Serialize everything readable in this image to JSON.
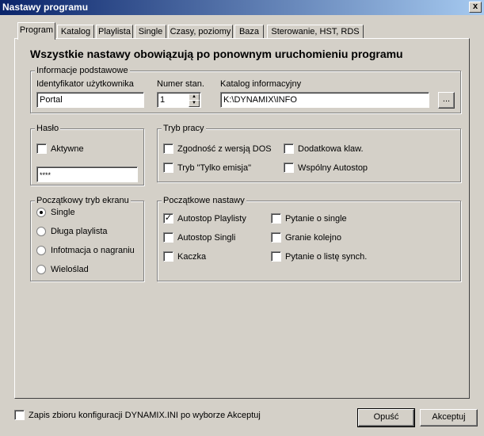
{
  "window": {
    "title": "Nastawy programu",
    "close_glyph": "x"
  },
  "tabs": [
    "Program",
    "Katalog",
    "Playlista",
    "Single",
    "Czasy, poziomy",
    "Baza",
    "Sterowanie, HST, RDS"
  ],
  "heading": "Wszystkie nastawy obowiązują po ponownym uruchomieniu programu",
  "basic": {
    "legend": "Informacje podstawowe",
    "user_id_label": "Identyfikator użytkownika",
    "user_id_value": "Portal",
    "station_label": "Numer stan.",
    "station_value": "1",
    "catalog_label": "Katalog informacyjny",
    "catalog_value": "K:\\DYNAMIX\\INFO",
    "browse_label": "..."
  },
  "password": {
    "legend": "Hasło",
    "active_label": "Aktywne",
    "active_checked": false,
    "value": "****"
  },
  "mode": {
    "legend": "Tryb pracy",
    "items": [
      {
        "label": "Zgodność z wersją DOS",
        "checked": false
      },
      {
        "label": "Dodatkowa klaw.",
        "checked": false
      },
      {
        "label": "Tryb \"Tylko emisja\"",
        "checked": false
      },
      {
        "label": "Wspólny Autostop",
        "checked": false
      }
    ]
  },
  "screen": {
    "legend": "Początkowy tryb ekranu",
    "options": [
      "Single",
      "Długa playlista",
      "Infotmacja o nagraniu",
      "Wieloślad"
    ],
    "selected": "Single"
  },
  "initial": {
    "legend": "Początkowe nastawy",
    "items": [
      {
        "label": "Autostop Playlisty",
        "checked": true
      },
      {
        "label": "Pytanie o single",
        "checked": false
      },
      {
        "label": "Autostop Singli",
        "checked": false
      },
      {
        "label": "Granie kolejno",
        "checked": false
      },
      {
        "label": "Kaczka",
        "checked": false
      },
      {
        "label": "Pytanie o listę synch.",
        "checked": false
      }
    ]
  },
  "footer": {
    "save_config_label": "Zapis zbioru konfiguracji DYNAMIX.INI po wyborze Akceptuj",
    "save_config_checked": false,
    "cancel_label": "Opuść",
    "accept_label": "Akceptuj"
  },
  "icons": {
    "check": "✓",
    "spin_up": "▲",
    "spin_down": "▼"
  },
  "colors": {
    "title_start": "#0a246a",
    "title_end": "#a6caf0",
    "face": "#d4d0c8"
  }
}
